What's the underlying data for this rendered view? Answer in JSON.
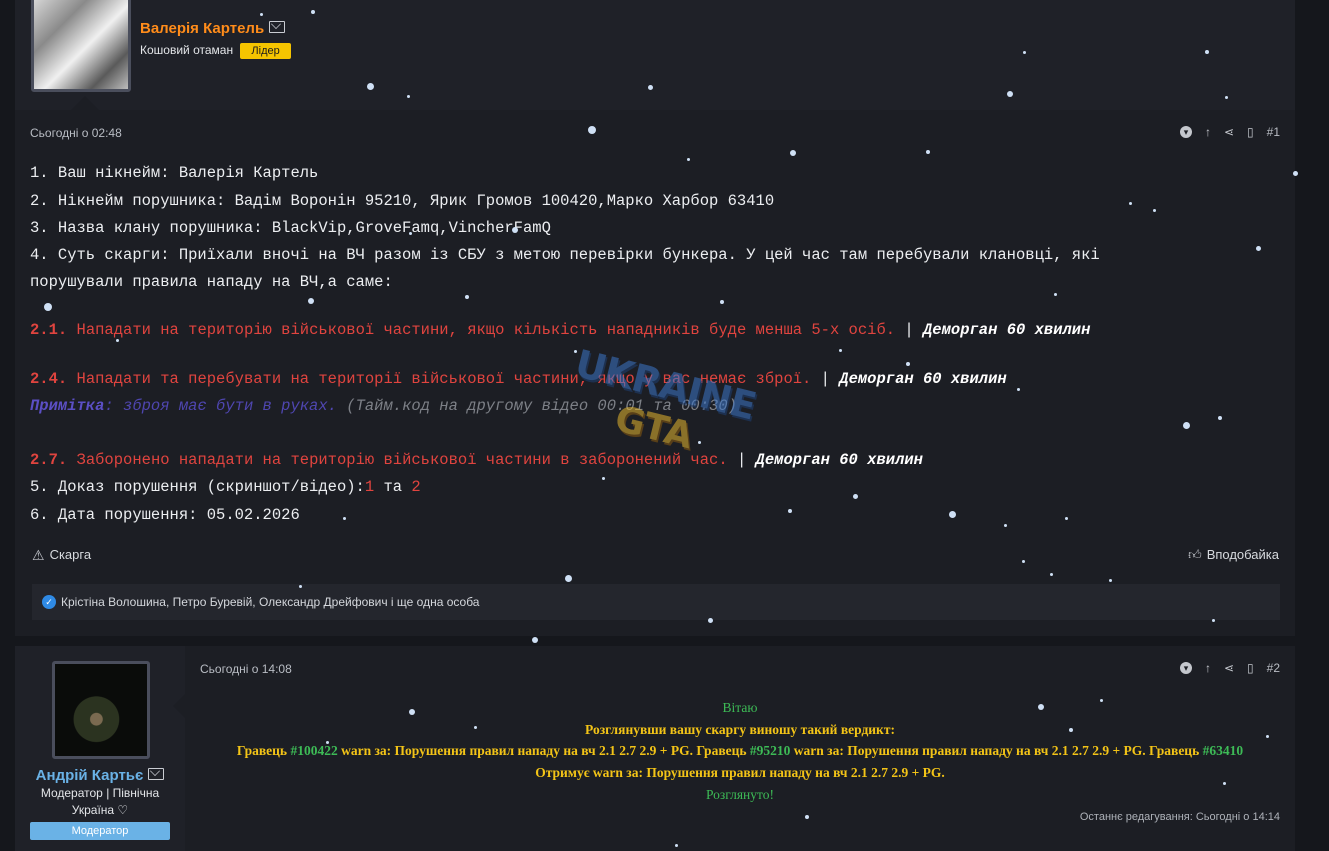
{
  "post1": {
    "author_name": "Валерія Картель",
    "author_title": "Кошовий отаман",
    "author_badge": "Лідер",
    "date": "Сьогодні о 02:48",
    "post_number": "#1",
    "lines": {
      "l1": "1. Ваш нікнейм: Валерія Картель",
      "l2": "2. Нікнейм порушника: Вадім Воронін 95210, Ярик Громов 100420,Марко Харбор 63410",
      "l3": "3. Назва клану порушника: BlackVip,GroveFamq,VincherFamQ",
      "l4a": "4. Суть скарги: Приїхали вночі на ВЧ разом із СБУ з метою перевірки бункера. У цей час там перебували клановці, які",
      "l4b": "порушували правила нападу на ВЧ,а саме:",
      "r1_num": "2.1.",
      "r1_text": "Нападати на територію військової частини, якщо кількість нападників буде менша 5-х осіб.",
      "r1_sep": " | ",
      "r1_punish": "Деморган 60 хвилин",
      "r2_num": "2.4.",
      "r2_text": "Нападати та перебувати на території військової частини, якщо у вас немає зброї.",
      "r2_sep": " | ",
      "r2_punish": "Деморган 60 хвилин",
      "note_label": "Примітка",
      "note_text": ": зброя має бути в руках.",
      "note_time": "(Тайм.код на другому відео 00:01 та 00:30)",
      "r3_num": "2.7.",
      "r3_text": "Заборонено нападати на територію військової частини в заборонений час.",
      "r3_sep": " | ",
      "r3_punish": "Деморган 60 хвилин",
      "l5_pre": "5. Доказ порушення (скриншот/відео):",
      "l5_link1": "1",
      "l5_mid": " та ",
      "l5_link2": "2",
      "l6": "6. Дата порушення: 05.02.2026"
    },
    "report_label": "Скарга",
    "like_label": "Вподобайка",
    "likes_text": "Крістіна Волошина, Петро Буревій, Олександр Дрейфович і ще одна особа"
  },
  "post2": {
    "author_name": "Андрій Картьє",
    "author_title_1": "Модератор | Північна",
    "author_title_2": "Україна ♡",
    "author_badge": "Модератор",
    "date": "Сьогодні о 14:08",
    "post_number": "#2",
    "greeting": "Вітаю",
    "line1": "Розглянувши вашу скаргу виношу такий вердикт:",
    "l2_a": "Гравець ",
    "l2_id1": "#100422",
    "l2_b": " warn за: Порушення правил нападу на вч 2.1 2.7 2.9 + PG. Гравець ",
    "l2_id2": "#95210",
    "l2_c": " warn за: Порушення правил нападу на вч 2.1 2.7 2.9 + PG. Гравець ",
    "l2_id3": "#63410",
    "line3": "Отримує warn за: Порушення правил нападу на вч 2.1 2.7 2.9 + PG.",
    "reviewed": "Розглянуто!",
    "edited": "Останнє редагування: Сьогодні о 14:14"
  },
  "watermark": {
    "line1": "UKRAINE",
    "line2": "GTA"
  },
  "colors": {
    "leader_badge": "#f5c400",
    "moderator_badge": "#6ab2e6",
    "rule_red": "#e0443f",
    "green": "#3dbb56",
    "yellow": "#f3c417"
  }
}
